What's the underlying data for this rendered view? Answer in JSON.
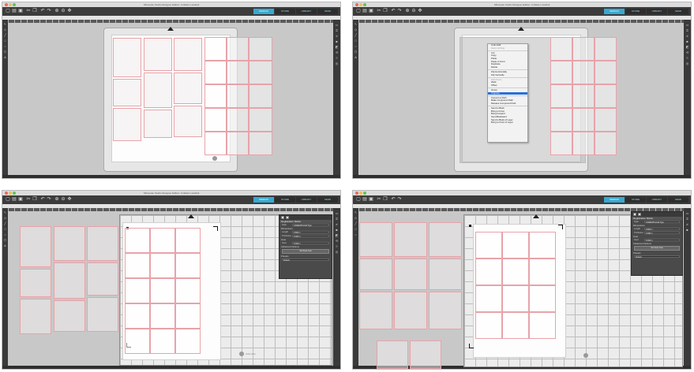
{
  "app": {
    "window_title": "Silhouette Studio Designer Edition: Untitled-1.studio3",
    "tabs": [
      {
        "label": "DESIGN",
        "active": true
      },
      {
        "label": "STORE",
        "active": false
      },
      {
        "label": "LIBRARY",
        "active": false
      },
      {
        "label": "SEND",
        "active": false
      }
    ],
    "brand": "silhouette"
  },
  "context_menu": {
    "items": [
      {
        "label": "Undo Edit",
        "state": "normal"
      },
      {
        "label": "Redo Nothing",
        "state": "dim"
      },
      {
        "sep": true
      },
      {
        "label": "Cut",
        "state": "normal"
      },
      {
        "label": "Copy",
        "state": "normal"
      },
      {
        "label": "Paste",
        "state": "normal"
      },
      {
        "label": "Paste In Front",
        "state": "normal"
      },
      {
        "label": "Duplicate",
        "state": "normal"
      },
      {
        "label": "Delete",
        "state": "normal"
      },
      {
        "sep": true
      },
      {
        "label": "Flip Horizontally",
        "state": "normal"
      },
      {
        "label": "Flip Vertically",
        "state": "normal"
      },
      {
        "sep": true
      },
      {
        "label": "Edit Points",
        "state": "dim"
      },
      {
        "label": "Weld",
        "state": "normal"
      },
      {
        "label": "Offset",
        "state": "normal"
      },
      {
        "sep": true
      },
      {
        "label": "Group",
        "state": "normal"
      },
      {
        "label": "Ungroup",
        "state": "highlight"
      },
      {
        "sep": true
      },
      {
        "label": "Convert to Path",
        "state": "normal"
      },
      {
        "label": "Make Compound Path",
        "state": "normal"
      },
      {
        "label": "Release Compound Path",
        "state": "normal"
      },
      {
        "sep": true
      },
      {
        "label": "Send to Back",
        "state": "normal"
      },
      {
        "label": "Bring to Front",
        "state": "normal"
      },
      {
        "label": "Bring Forward",
        "state": "normal"
      },
      {
        "label": "Send Backward",
        "state": "normal"
      },
      {
        "label": "Send to Back of Layer",
        "state": "normal"
      },
      {
        "label": "Bring to Front of Layer",
        "state": "normal"
      }
    ]
  },
  "panel": {
    "title": "Registration Marks",
    "style_label": "Style",
    "style_value": "CAMEO/Portrait Type",
    "sections": [
      "Dimensions",
      "Inset"
    ],
    "length_label": "Length",
    "length_value": "0.500 in",
    "thickness_label": "Thickness",
    "thickness_value": "0.020 in",
    "inset_label": "Inset",
    "inset_value": "0.394 in",
    "advanced_label": "Advanced Options",
    "button_label": "Set Scan Area",
    "preset_label": "Presets",
    "preset_value": "Default"
  },
  "colors": {
    "accent": "#37a9d1",
    "toolbar": "#3c3c3c",
    "canvas": "#c8c8c8",
    "card_outline": "#e7a3a9",
    "menu_highlight": "#2b6fd6"
  }
}
